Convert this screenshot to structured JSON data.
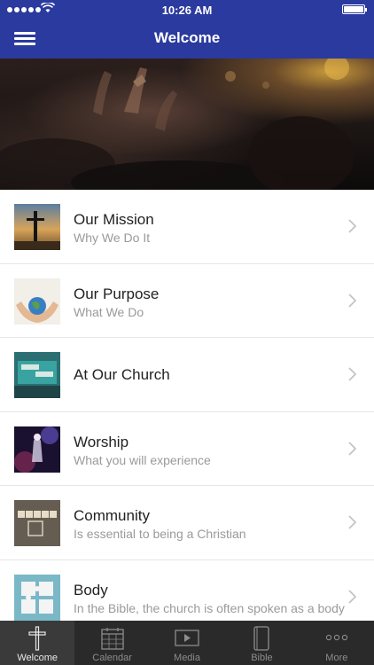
{
  "status_bar": {
    "time": "10:26 AM",
    "signal": "signal-dots",
    "wifi_icon": "wifi-icon"
  },
  "nav": {
    "title": "Welcome",
    "menu_icon": "hamburger-menu-icon"
  },
  "colors": {
    "nav_bg": "#2b3a9e",
    "tabbar_bg": "#2a2a2a",
    "subtitle": "#9a9a9a"
  },
  "items": [
    {
      "title": "Our Mission",
      "subtitle": "Why We Do It",
      "thumb": "cross-sunset-thumb"
    },
    {
      "title": "Our Purpose",
      "subtitle": "What We Do",
      "thumb": "hands-globe-thumb"
    },
    {
      "title": "At Our Church",
      "subtitle": "",
      "thumb": "church-sign-thumb"
    },
    {
      "title": "Worship",
      "subtitle": "What you will experience",
      "thumb": "worship-band-thumb"
    },
    {
      "title": "Community",
      "subtitle": "Is essential to being a Christian",
      "thumb": "community-blocks-thumb"
    },
    {
      "title": "Body",
      "subtitle": "In the Bible, the church is often spoken as a body",
      "thumb": "puzzle-hands-thumb"
    }
  ],
  "tabs": [
    {
      "label": "Welcome",
      "icon": "cross-icon",
      "active": true
    },
    {
      "label": "Calendar",
      "icon": "calendar-icon",
      "active": false
    },
    {
      "label": "Media",
      "icon": "play-icon",
      "active": false
    },
    {
      "label": "Bible",
      "icon": "book-icon",
      "active": false
    },
    {
      "label": "More",
      "icon": "more-dots-icon",
      "active": false
    }
  ]
}
